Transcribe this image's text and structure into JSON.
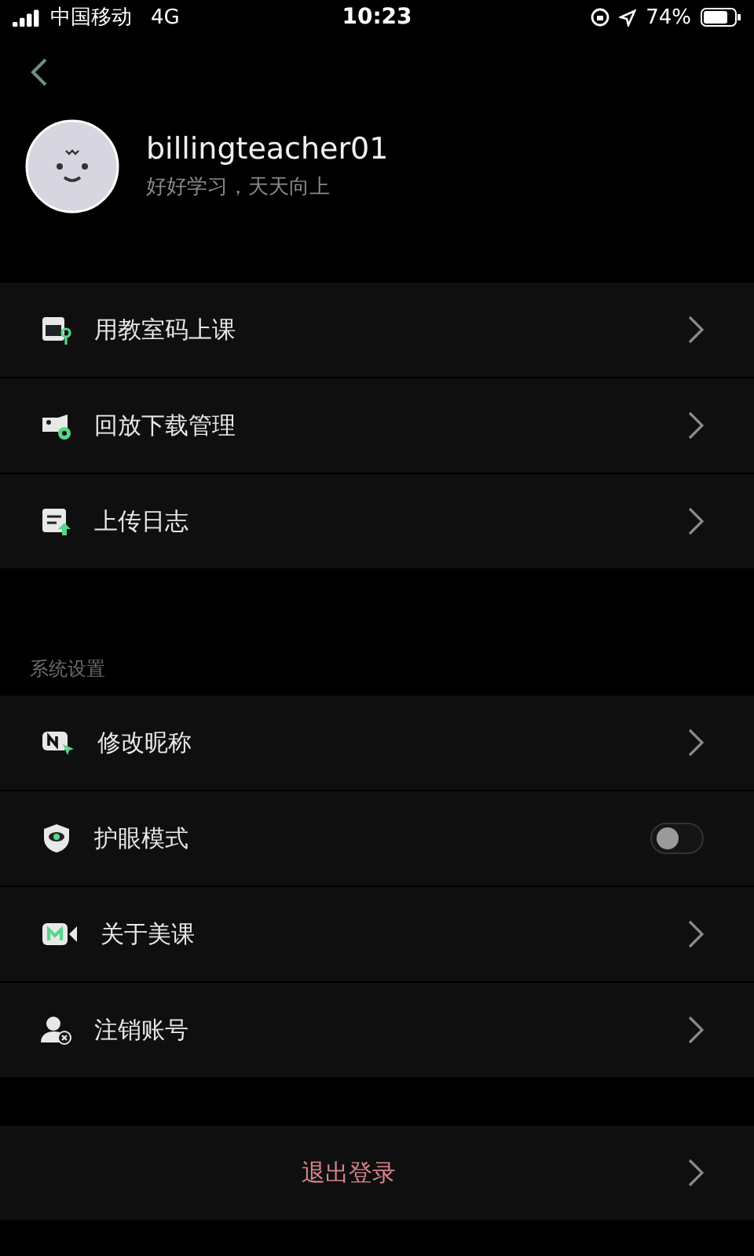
{
  "status_bar": {
    "carrier": "中国移动",
    "network": "4G",
    "time": "10:23",
    "battery": "74%"
  },
  "profile": {
    "username": "billingteacher01",
    "motto": "好好学习，天天向上"
  },
  "menu": [
    {
      "kind": "link",
      "label": "用教室码上课"
    },
    {
      "kind": "link",
      "label": "回放下载管理"
    },
    {
      "kind": "link",
      "label": "上传日志"
    }
  ],
  "settings": {
    "title": "系统设置",
    "items": [
      {
        "kind": "link",
        "label": "修改昵称"
      },
      {
        "kind": "toggle",
        "label": "护眼模式",
        "on": false
      },
      {
        "kind": "link",
        "label": "关于美课"
      },
      {
        "kind": "link",
        "label": "注销账号"
      }
    ]
  },
  "logout": {
    "label": "退出登录"
  }
}
